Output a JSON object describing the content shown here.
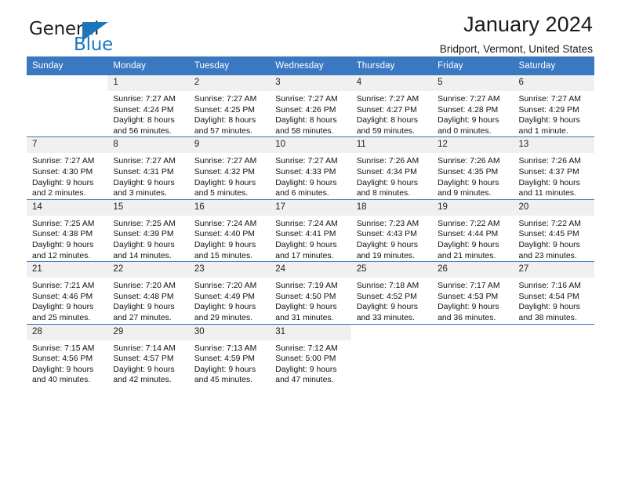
{
  "logo": {
    "word1": "General",
    "word2": "Blue",
    "triangle_color": "#1b75bb"
  },
  "header": {
    "title": "January 2024",
    "subtitle": "Bridport, Vermont, United States"
  },
  "theme": {
    "header_blue": "#3a78c2",
    "daynum_band": "#f0f0f0",
    "grid_line": "#3a78c2"
  },
  "weekday_headers": [
    "Sunday",
    "Monday",
    "Tuesday",
    "Wednesday",
    "Thursday",
    "Friday",
    "Saturday"
  ],
  "weeks": [
    [
      {
        "day": "",
        "sunrise": "",
        "sunset": "",
        "daylight1": "",
        "daylight2": ""
      },
      {
        "day": "1",
        "sunrise": "Sunrise: 7:27 AM",
        "sunset": "Sunset: 4:24 PM",
        "daylight1": "Daylight: 8 hours",
        "daylight2": "and 56 minutes."
      },
      {
        "day": "2",
        "sunrise": "Sunrise: 7:27 AM",
        "sunset": "Sunset: 4:25 PM",
        "daylight1": "Daylight: 8 hours",
        "daylight2": "and 57 minutes."
      },
      {
        "day": "3",
        "sunrise": "Sunrise: 7:27 AM",
        "sunset": "Sunset: 4:26 PM",
        "daylight1": "Daylight: 8 hours",
        "daylight2": "and 58 minutes."
      },
      {
        "day": "4",
        "sunrise": "Sunrise: 7:27 AM",
        "sunset": "Sunset: 4:27 PM",
        "daylight1": "Daylight: 8 hours",
        "daylight2": "and 59 minutes."
      },
      {
        "day": "5",
        "sunrise": "Sunrise: 7:27 AM",
        "sunset": "Sunset: 4:28 PM",
        "daylight1": "Daylight: 9 hours",
        "daylight2": "and 0 minutes."
      },
      {
        "day": "6",
        "sunrise": "Sunrise: 7:27 AM",
        "sunset": "Sunset: 4:29 PM",
        "daylight1": "Daylight: 9 hours",
        "daylight2": "and 1 minute."
      }
    ],
    [
      {
        "day": "7",
        "sunrise": "Sunrise: 7:27 AM",
        "sunset": "Sunset: 4:30 PM",
        "daylight1": "Daylight: 9 hours",
        "daylight2": "and 2 minutes."
      },
      {
        "day": "8",
        "sunrise": "Sunrise: 7:27 AM",
        "sunset": "Sunset: 4:31 PM",
        "daylight1": "Daylight: 9 hours",
        "daylight2": "and 3 minutes."
      },
      {
        "day": "9",
        "sunrise": "Sunrise: 7:27 AM",
        "sunset": "Sunset: 4:32 PM",
        "daylight1": "Daylight: 9 hours",
        "daylight2": "and 5 minutes."
      },
      {
        "day": "10",
        "sunrise": "Sunrise: 7:27 AM",
        "sunset": "Sunset: 4:33 PM",
        "daylight1": "Daylight: 9 hours",
        "daylight2": "and 6 minutes."
      },
      {
        "day": "11",
        "sunrise": "Sunrise: 7:26 AM",
        "sunset": "Sunset: 4:34 PM",
        "daylight1": "Daylight: 9 hours",
        "daylight2": "and 8 minutes."
      },
      {
        "day": "12",
        "sunrise": "Sunrise: 7:26 AM",
        "sunset": "Sunset: 4:35 PM",
        "daylight1": "Daylight: 9 hours",
        "daylight2": "and 9 minutes."
      },
      {
        "day": "13",
        "sunrise": "Sunrise: 7:26 AM",
        "sunset": "Sunset: 4:37 PM",
        "daylight1": "Daylight: 9 hours",
        "daylight2": "and 11 minutes."
      }
    ],
    [
      {
        "day": "14",
        "sunrise": "Sunrise: 7:25 AM",
        "sunset": "Sunset: 4:38 PM",
        "daylight1": "Daylight: 9 hours",
        "daylight2": "and 12 minutes."
      },
      {
        "day": "15",
        "sunrise": "Sunrise: 7:25 AM",
        "sunset": "Sunset: 4:39 PM",
        "daylight1": "Daylight: 9 hours",
        "daylight2": "and 14 minutes."
      },
      {
        "day": "16",
        "sunrise": "Sunrise: 7:24 AM",
        "sunset": "Sunset: 4:40 PM",
        "daylight1": "Daylight: 9 hours",
        "daylight2": "and 15 minutes."
      },
      {
        "day": "17",
        "sunrise": "Sunrise: 7:24 AM",
        "sunset": "Sunset: 4:41 PM",
        "daylight1": "Daylight: 9 hours",
        "daylight2": "and 17 minutes."
      },
      {
        "day": "18",
        "sunrise": "Sunrise: 7:23 AM",
        "sunset": "Sunset: 4:43 PM",
        "daylight1": "Daylight: 9 hours",
        "daylight2": "and 19 minutes."
      },
      {
        "day": "19",
        "sunrise": "Sunrise: 7:22 AM",
        "sunset": "Sunset: 4:44 PM",
        "daylight1": "Daylight: 9 hours",
        "daylight2": "and 21 minutes."
      },
      {
        "day": "20",
        "sunrise": "Sunrise: 7:22 AM",
        "sunset": "Sunset: 4:45 PM",
        "daylight1": "Daylight: 9 hours",
        "daylight2": "and 23 minutes."
      }
    ],
    [
      {
        "day": "21",
        "sunrise": "Sunrise: 7:21 AM",
        "sunset": "Sunset: 4:46 PM",
        "daylight1": "Daylight: 9 hours",
        "daylight2": "and 25 minutes."
      },
      {
        "day": "22",
        "sunrise": "Sunrise: 7:20 AM",
        "sunset": "Sunset: 4:48 PM",
        "daylight1": "Daylight: 9 hours",
        "daylight2": "and 27 minutes."
      },
      {
        "day": "23",
        "sunrise": "Sunrise: 7:20 AM",
        "sunset": "Sunset: 4:49 PM",
        "daylight1": "Daylight: 9 hours",
        "daylight2": "and 29 minutes."
      },
      {
        "day": "24",
        "sunrise": "Sunrise: 7:19 AM",
        "sunset": "Sunset: 4:50 PM",
        "daylight1": "Daylight: 9 hours",
        "daylight2": "and 31 minutes."
      },
      {
        "day": "25",
        "sunrise": "Sunrise: 7:18 AM",
        "sunset": "Sunset: 4:52 PM",
        "daylight1": "Daylight: 9 hours",
        "daylight2": "and 33 minutes."
      },
      {
        "day": "26",
        "sunrise": "Sunrise: 7:17 AM",
        "sunset": "Sunset: 4:53 PM",
        "daylight1": "Daylight: 9 hours",
        "daylight2": "and 36 minutes."
      },
      {
        "day": "27",
        "sunrise": "Sunrise: 7:16 AM",
        "sunset": "Sunset: 4:54 PM",
        "daylight1": "Daylight: 9 hours",
        "daylight2": "and 38 minutes."
      }
    ],
    [
      {
        "day": "28",
        "sunrise": "Sunrise: 7:15 AM",
        "sunset": "Sunset: 4:56 PM",
        "daylight1": "Daylight: 9 hours",
        "daylight2": "and 40 minutes."
      },
      {
        "day": "29",
        "sunrise": "Sunrise: 7:14 AM",
        "sunset": "Sunset: 4:57 PM",
        "daylight1": "Daylight: 9 hours",
        "daylight2": "and 42 minutes."
      },
      {
        "day": "30",
        "sunrise": "Sunrise: 7:13 AM",
        "sunset": "Sunset: 4:59 PM",
        "daylight1": "Daylight: 9 hours",
        "daylight2": "and 45 minutes."
      },
      {
        "day": "31",
        "sunrise": "Sunrise: 7:12 AM",
        "sunset": "Sunset: 5:00 PM",
        "daylight1": "Daylight: 9 hours",
        "daylight2": "and 47 minutes."
      },
      {
        "day": "",
        "sunrise": "",
        "sunset": "",
        "daylight1": "",
        "daylight2": ""
      },
      {
        "day": "",
        "sunrise": "",
        "sunset": "",
        "daylight1": "",
        "daylight2": ""
      },
      {
        "day": "",
        "sunrise": "",
        "sunset": "",
        "daylight1": "",
        "daylight2": ""
      }
    ]
  ]
}
